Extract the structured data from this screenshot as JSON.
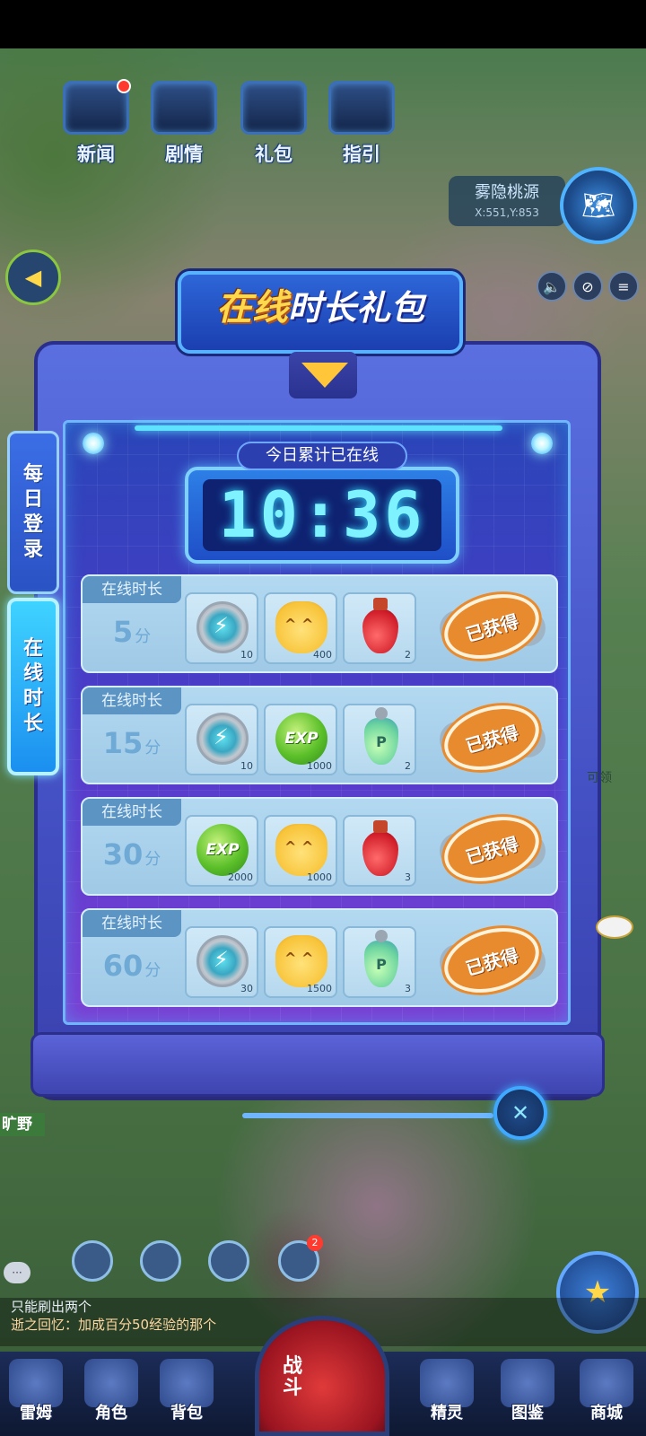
{
  "hud": {
    "top_icons": [
      {
        "label": "新闻",
        "badge": true
      },
      {
        "label": "剧情",
        "badge": false
      },
      {
        "label": "礼包",
        "badge": false
      },
      {
        "label": "指引",
        "badge": false
      }
    ],
    "location": {
      "name": "雾隐桃源",
      "coords": "X:551,Y:853"
    }
  },
  "panel": {
    "title_part1": "在线",
    "title_part2": "时长礼包",
    "tabs": [
      {
        "label": "每日登录",
        "active": false
      },
      {
        "label": "在线时长",
        "active": true
      }
    ],
    "timer": {
      "caption": "今日累计已在线",
      "value": "10:36"
    },
    "rows": [
      {
        "tag": "在线时长",
        "duration": "5",
        "unit": "分",
        "items": [
          {
            "icon": "energy-gear-icon",
            "count": "10"
          },
          {
            "icon": "yellow-cat-icon",
            "count": "400"
          },
          {
            "icon": "red-potion-icon",
            "count": "2"
          }
        ],
        "status": "已获得"
      },
      {
        "tag": "在线时长",
        "duration": "15",
        "unit": "分",
        "items": [
          {
            "icon": "energy-gear-icon",
            "count": "10"
          },
          {
            "icon": "exp-orb-icon",
            "count": "1000"
          },
          {
            "icon": "p-potion-icon",
            "count": "2"
          }
        ],
        "status": "已获得"
      },
      {
        "tag": "在线时长",
        "duration": "30",
        "unit": "分",
        "items": [
          {
            "icon": "exp-orb-icon",
            "count": "2000"
          },
          {
            "icon": "yellow-cat-icon",
            "count": "1000"
          },
          {
            "icon": "red-potion-icon",
            "count": "3"
          }
        ],
        "status": "已获得"
      },
      {
        "tag": "在线时长",
        "duration": "60",
        "unit": "分",
        "items": [
          {
            "icon": "energy-gear-icon",
            "count": "30"
          },
          {
            "icon": "yellow-cat-icon",
            "count": "1500"
          },
          {
            "icon": "p-potion-icon",
            "count": "3"
          }
        ],
        "status": "已获得"
      }
    ],
    "item_text": {
      "exp": "EXP",
      "p": "P"
    }
  },
  "background": {
    "side_claim": "可领",
    "wild_tag": "旷野"
  },
  "action_badge": "2",
  "chat": {
    "line1": "只能刷出两个",
    "line2": "逝之回忆：加成百分50经验的那个"
  },
  "bottom_nav": [
    "雷姆",
    "角色",
    "背包",
    "精灵",
    "图鉴",
    "商城"
  ],
  "battle": {
    "line1": "战",
    "line2": "斗"
  },
  "colors": {
    "accent_cyan": "#7ef3ff",
    "claimed_orange": "#e88a2e",
    "title_yellow": "#ffd84b"
  }
}
